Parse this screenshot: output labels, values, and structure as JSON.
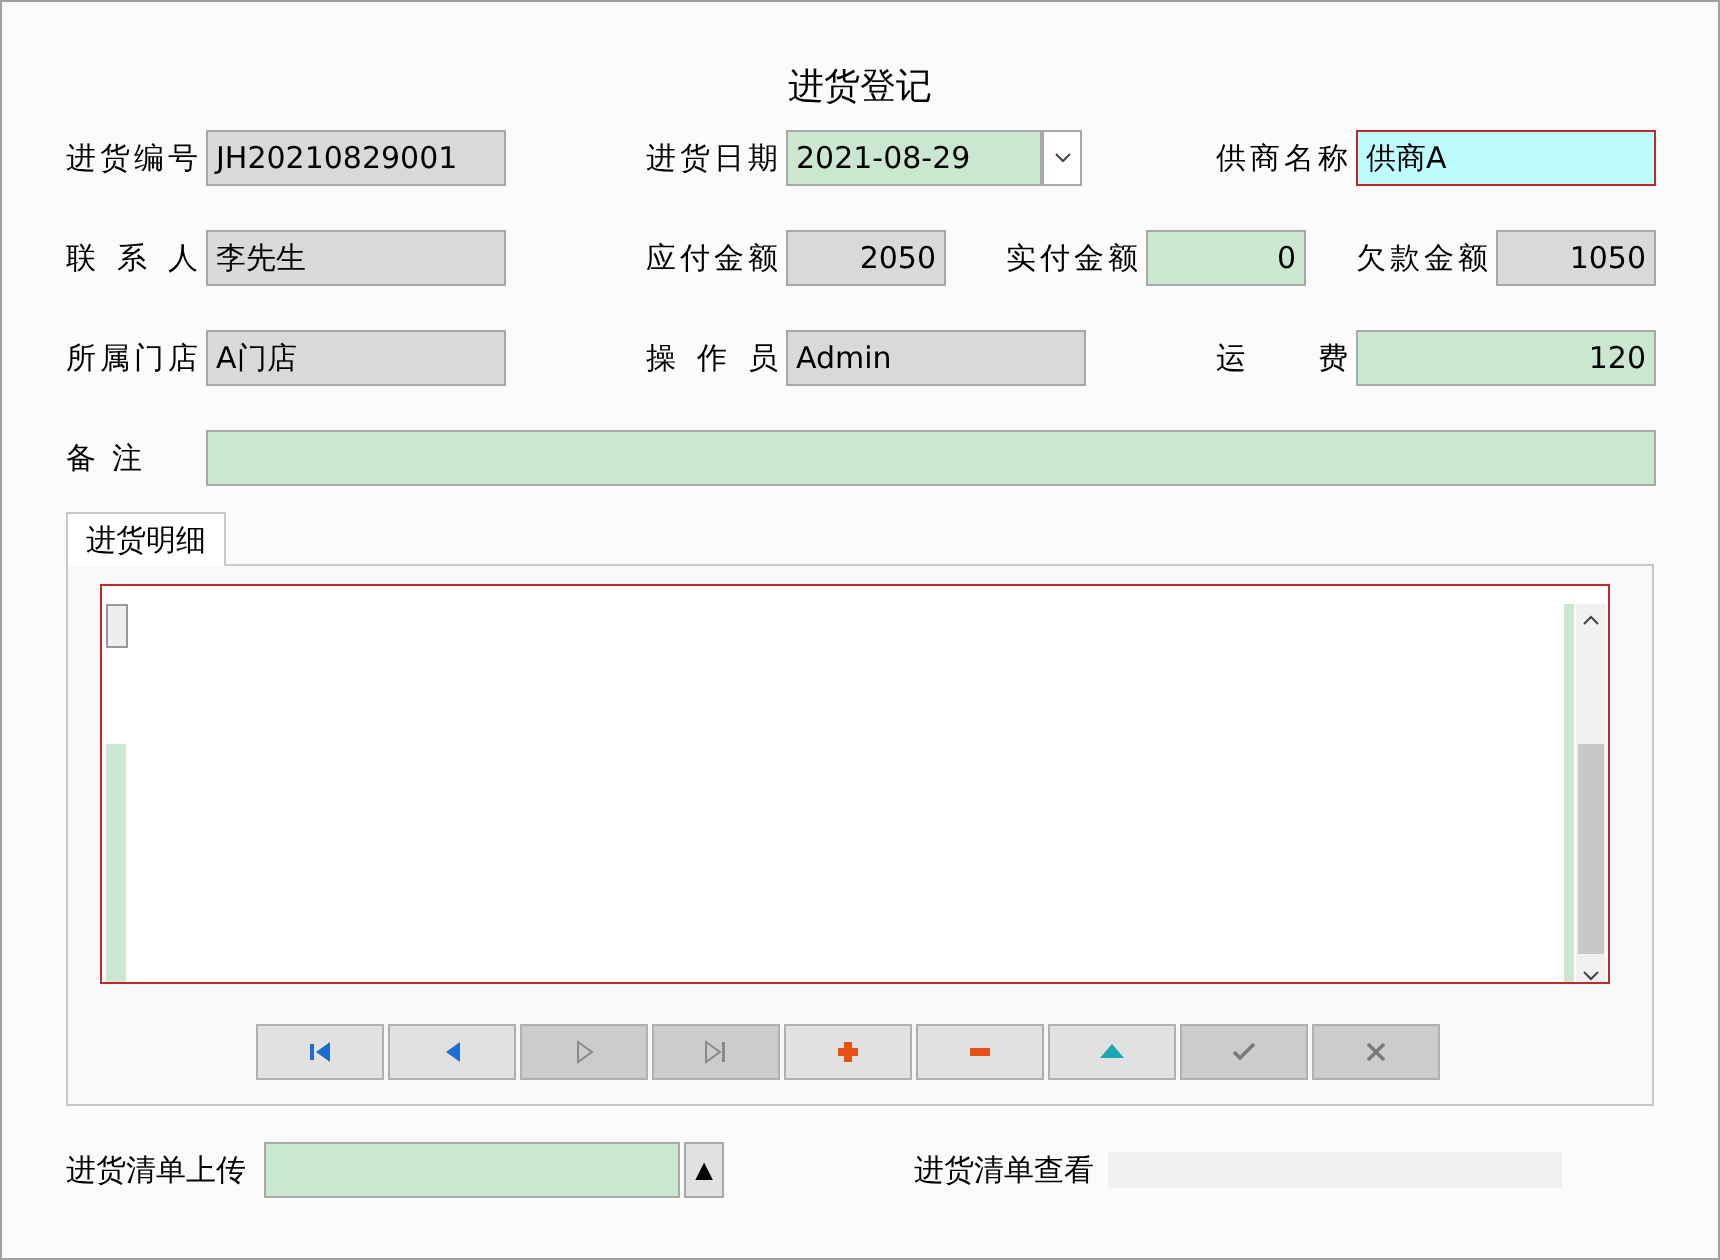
{
  "title": "进货登记",
  "rows": [
    [
      {
        "label": "进货编号",
        "value": "JH20210829001",
        "kind": "readonly",
        "numeric": false,
        "focused": false
      },
      {
        "label": "进货日期",
        "value": "2021-08-29",
        "kind": "date",
        "numeric": false,
        "focused": false
      },
      {
        "label": "供商名称",
        "value": "供商A",
        "kind": "editable",
        "numeric": false,
        "focused": true
      }
    ],
    [
      {
        "label": "联系人",
        "value": "李先生",
        "kind": "readonly",
        "numeric": false,
        "focused": false
      },
      {
        "label": "应付金额",
        "value": "2050",
        "kind": "readonly",
        "numeric": true,
        "focused": false
      },
      {
        "label": "实付金额",
        "value": "0",
        "kind": "editable",
        "numeric": true,
        "focused": false
      },
      {
        "label": "欠款金额",
        "value": "1050",
        "kind": "readonly",
        "numeric": true,
        "focused": false
      }
    ],
    [
      {
        "label": "所属门店",
        "value": "A门店",
        "kind": "readonly",
        "numeric": false,
        "focused": false
      },
      {
        "label": "操作员",
        "value": "Admin",
        "kind": "readonly",
        "numeric": false,
        "focused": false
      },
      {
        "label": "运费",
        "value": "120",
        "kind": "editable",
        "numeric": true,
        "focused": false
      }
    ],
    [
      {
        "label": "备注",
        "kind": "editable",
        "focused": false
      }
    ]
  ],
  "tabs": [
    {
      "label": "进货明细",
      "selected": true
    }
  ],
  "navigator": [
    {
      "kind": "first",
      "disabled": false
    },
    {
      "kind": "prior",
      "disabled": false
    },
    {
      "kind": "next",
      "disabled": true
    },
    {
      "kind": "last",
      "disabled": true
    },
    {
      "kind": "insert",
      "disabled": false
    },
    {
      "kind": "delete",
      "disabled": false
    },
    {
      "kind": "edit",
      "disabled": false
    },
    {
      "kind": "post",
      "disabled": true
    },
    {
      "kind": "cancel",
      "disabled": true
    }
  ],
  "upload": {
    "label": "进货清单上传",
    "button": "▲"
  },
  "view": {
    "label": "进货清单查看"
  }
}
